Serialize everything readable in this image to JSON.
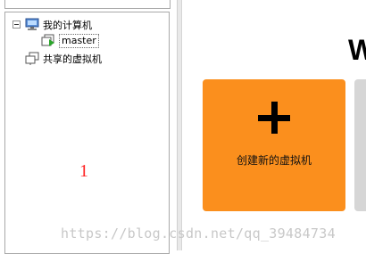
{
  "tree": {
    "items": [
      {
        "label": "我的计算机",
        "icon": "computer-icon",
        "expanded": true
      },
      {
        "label": "master",
        "icon": "vm-icon",
        "selected": true
      },
      {
        "label": "共享的虚拟机",
        "icon": "shared-vms-icon"
      }
    ]
  },
  "annotation": {
    "number": "1",
    "color": "#ff2020"
  },
  "main": {
    "heading_partial": "W",
    "create_tile": {
      "label": "创建新的虚拟机",
      "color": "#fb8f1d",
      "icon": "plus-icon"
    }
  },
  "watermark": "https://blog.csdn.net/qq_39484734"
}
